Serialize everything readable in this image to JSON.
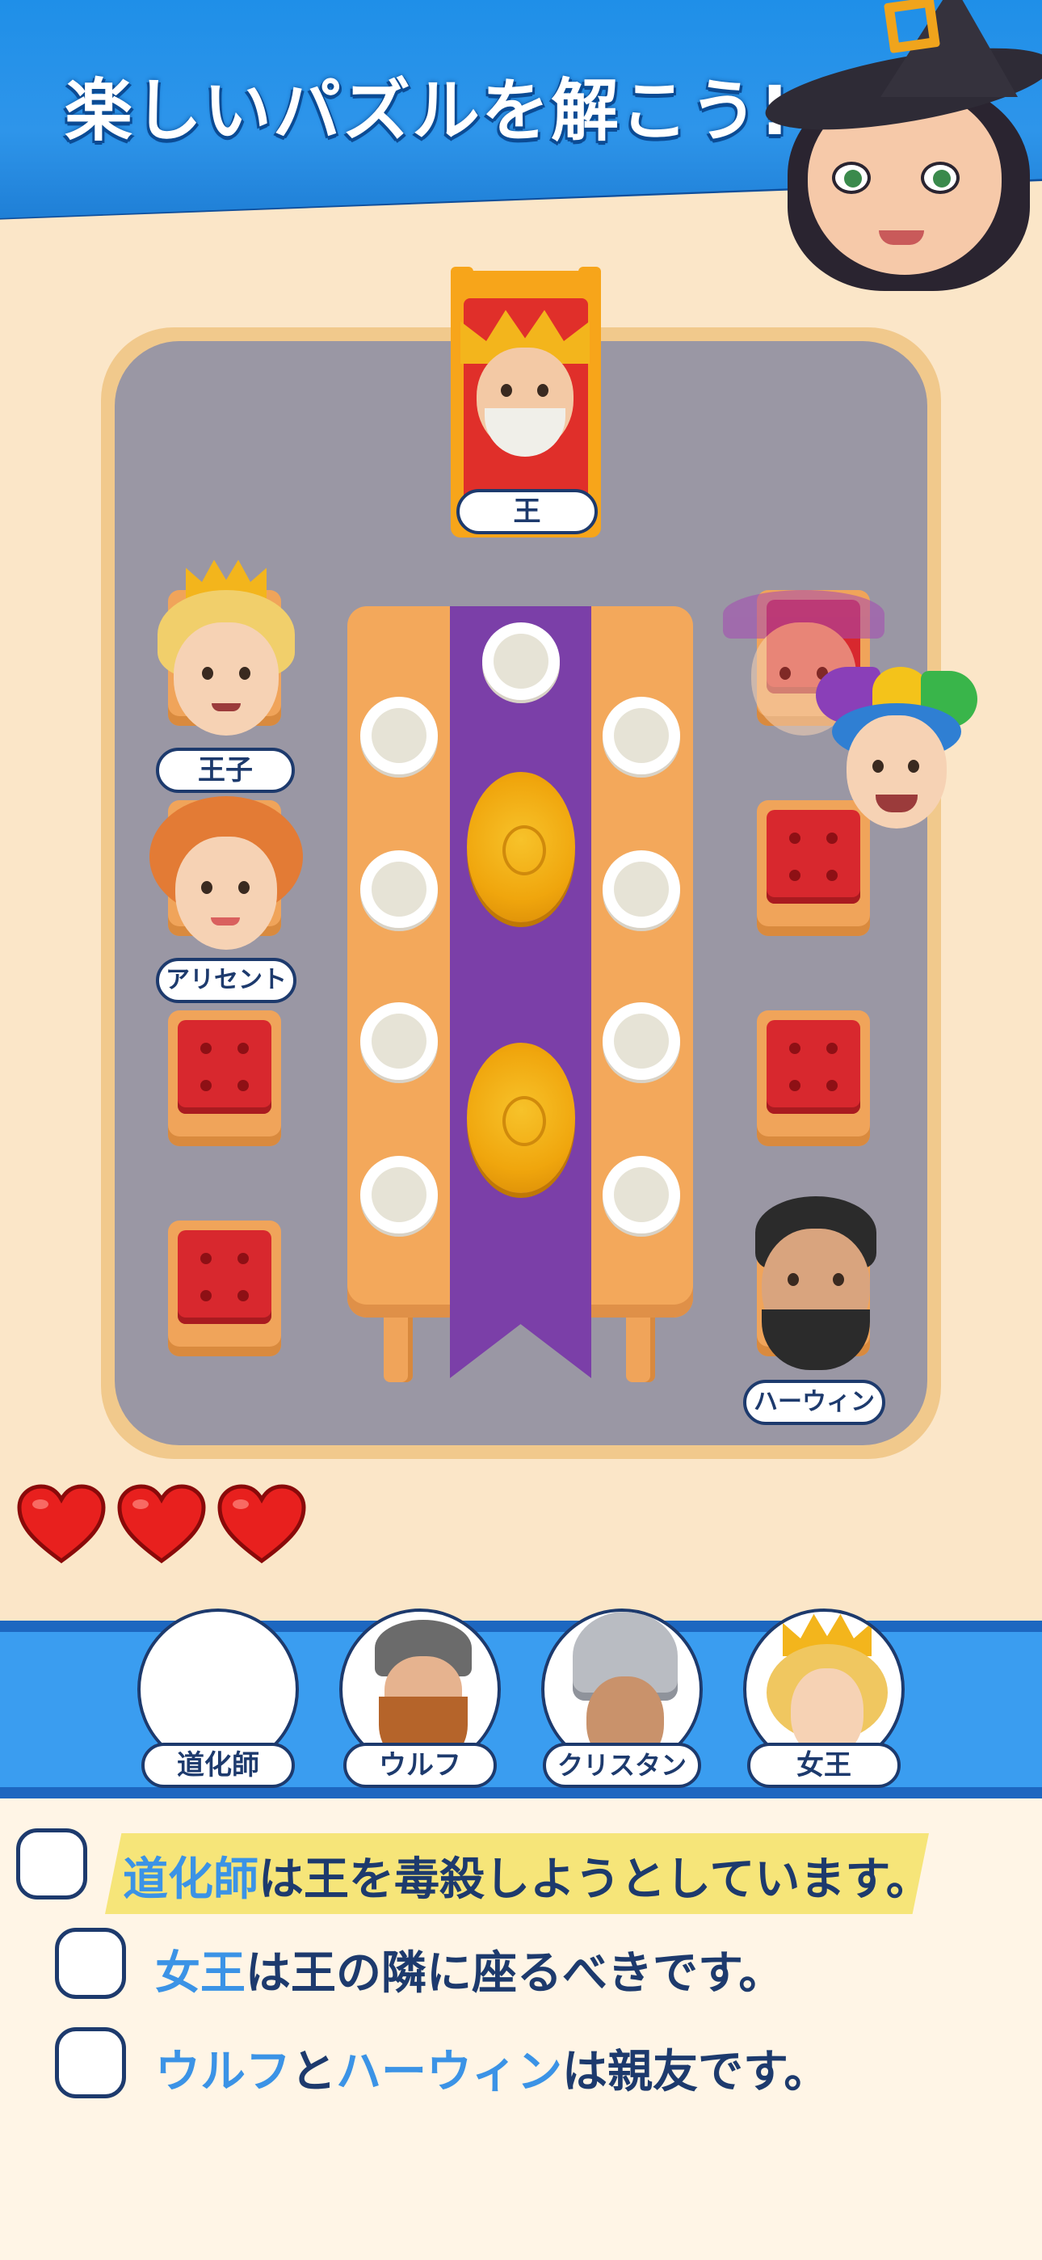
{
  "banner": {
    "title": "楽しいパズルを解こう!"
  },
  "board": {
    "characters": {
      "king": "王",
      "prince": "王子",
      "arissent": "アリセント",
      "harwin": "ハーウィン"
    }
  },
  "lives": {
    "hearts": 3,
    "max": 3
  },
  "roster": [
    {
      "label": "道化師",
      "placed": true
    },
    {
      "label": "ウルフ",
      "placed": false
    },
    {
      "label": "クリスタン",
      "placed": false
    },
    {
      "label": "女王",
      "placed": false
    }
  ],
  "clues": [
    {
      "kw1": "道化師",
      "rest": "は王を毒殺しようとしています。",
      "checked": false,
      "highlighted": true
    },
    {
      "kw1": "女王",
      "rest": "は王の隣に座るべきです。",
      "checked": false,
      "highlighted": false
    },
    {
      "kw1": "ウルフ",
      "mid": "と",
      "kw2": "ハーウィン",
      "rest": "は親友です。",
      "checked": false,
      "highlighted": false
    }
  ],
  "colors": {
    "banner": "#2e95ea",
    "board": "#9a97a4",
    "runner": "#7b3fa8",
    "keyword": "#3b93e6",
    "text": "#1d3a6d",
    "heart": "#e8201e"
  }
}
